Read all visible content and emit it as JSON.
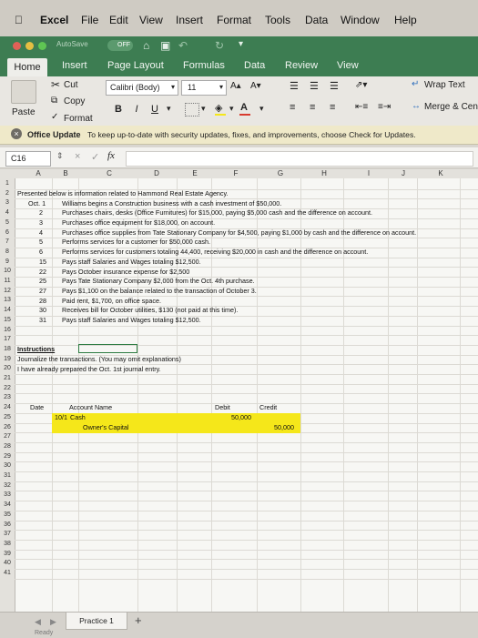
{
  "menu": {
    "app": "Excel",
    "items": [
      "File",
      "Edit",
      "View",
      "Insert",
      "Format",
      "Tools",
      "Data",
      "Window",
      "Help"
    ]
  },
  "titlebar": {
    "autosave": "AutoSave",
    "autosave_state": "OFF"
  },
  "ribbon_tabs": [
    "Home",
    "Insert",
    "Page Layout",
    "Formulas",
    "Data",
    "Review",
    "View"
  ],
  "ribbon": {
    "paste": "Paste",
    "cut": "Cut",
    "copy": "Copy",
    "format": "Format",
    "font_name": "Calibri (Body)",
    "font_size": "11",
    "bold": "B",
    "italic": "I",
    "underline": "U",
    "wrap_text": "Wrap Text",
    "merge": "Merge & Cen"
  },
  "update_bar": {
    "title": "Office Update",
    "message": "To keep up-to-date with security updates, fixes, and improvements, choose Check for Updates."
  },
  "formula_bar": {
    "name_box": "C16",
    "fx": "fx",
    "content": ""
  },
  "columns": [
    "A",
    "B",
    "C",
    "D",
    "E",
    "F",
    "G",
    "H",
    "I",
    "J",
    "K"
  ],
  "row_numbers": [
    "1",
    "2",
    "3",
    "4",
    "5",
    "6",
    "7",
    "8",
    "9",
    "10",
    "11",
    "12",
    "13",
    "14",
    "15",
    "16",
    "17",
    "18",
    "19",
    "20",
    "21",
    "22",
    "23",
    "24",
    "25",
    "26",
    "27",
    "28",
    "29",
    "30",
    "31",
    "32",
    "33",
    "34",
    "35",
    "36",
    "37",
    "38",
    "39",
    "40",
    "41"
  ],
  "sheet": {
    "intro": "Presented below is information related to Hammond Real Estate Agency.",
    "transactions": [
      {
        "date": "Oct. 1",
        "text": "Williams begins a Construction business with a cash investment of $50,000."
      },
      {
        "date": "2",
        "text": "Purchases chairs, desks (Office Furnitures) for $15,000, paying $5,000 cash and the difference on account."
      },
      {
        "date": "3",
        "text": "Purchases office equipment for $18,000, on account."
      },
      {
        "date": "4",
        "text": "Purchases office supplies from Tate Stationary Company for $4,500, paying $1,000 by cash and the difference on account."
      },
      {
        "date": "5",
        "text": "Performs services for a customer for $50,000 cash."
      },
      {
        "date": "6",
        "text": "Performs services for customers totaling 44,400, receiving $20,000 in cash and the difference on account."
      },
      {
        "date": "15",
        "text": "Pays staff Salaries and Wages totaling $12,500."
      },
      {
        "date": "22",
        "text": "Pays October insurance expense for $2,500"
      },
      {
        "date": "25",
        "text": "Pays Tate Stationary Company $2,000 from the Oct. 4th purchase."
      },
      {
        "date": "27",
        "text": "Pays $1,100 on the balance related to the transaction of October 3."
      },
      {
        "date": "28",
        "text": "Paid rent, $1,700, on office space."
      },
      {
        "date": "30",
        "text": "Receives bill for October utilities, $130 (not paid at this time)."
      },
      {
        "date": "31",
        "text": "Pays staff Salaries and Wages totaling $12,500."
      }
    ],
    "instructions_title": "Instructions",
    "instructions_1": "Journalize the transactions. (You may omit explanations)",
    "instructions_2": "I have already prepared the Oct. 1st journal entry.",
    "journal": {
      "headers": {
        "date": "Date",
        "account": "Account Name",
        "debit": "Debit",
        "credit": "Credit"
      },
      "row1": {
        "date": "10/1",
        "account": "Cash",
        "debit": "50,000"
      },
      "row2": {
        "account": "Owner's Capital",
        "credit": "50,000"
      }
    }
  },
  "sheet_tabs": {
    "active": "Practice 1",
    "add": "+",
    "status": "Ready"
  },
  "colors": {
    "title_green": "#3d7d52",
    "highlight_yellow": "#f5e71a",
    "update_bar": "#efe9c9"
  }
}
